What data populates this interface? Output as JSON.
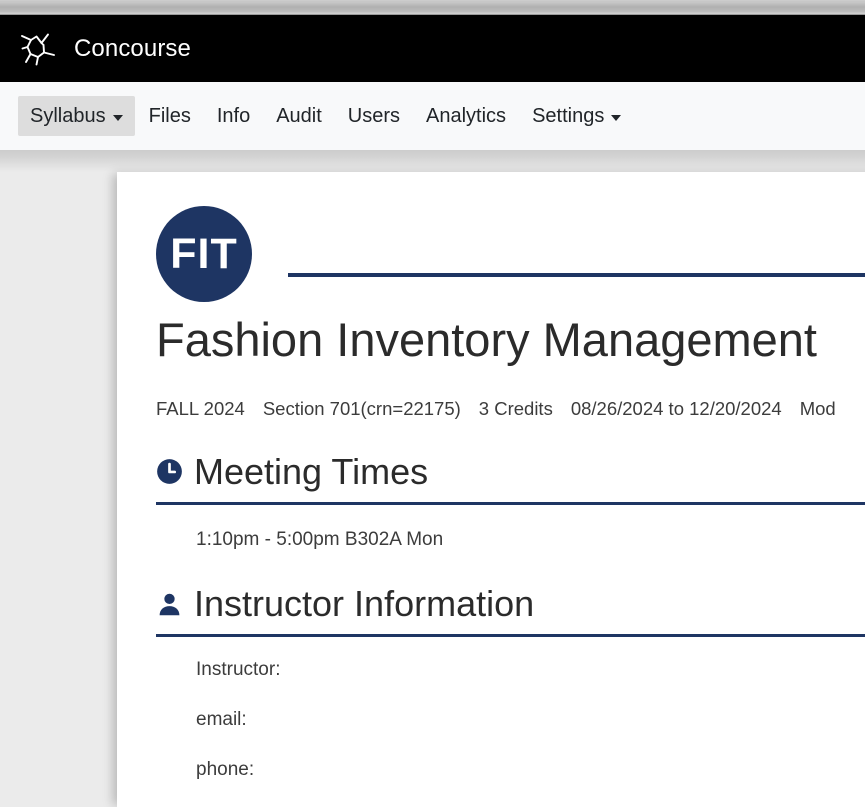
{
  "browser": {
    "scrollbar": "horizontal-scrollbar"
  },
  "header": {
    "brand_name": "Concourse",
    "logo_icon": "concourse-starburst-logo"
  },
  "nav": {
    "items": [
      {
        "label": "Syllabus",
        "has_caret": true,
        "active": true
      },
      {
        "label": "Files",
        "has_caret": false,
        "active": false
      },
      {
        "label": "Info",
        "has_caret": false,
        "active": false
      },
      {
        "label": "Audit",
        "has_caret": false,
        "active": false
      },
      {
        "label": "Users",
        "has_caret": false,
        "active": false
      },
      {
        "label": "Analytics",
        "has_caret": false,
        "active": false
      },
      {
        "label": "Settings",
        "has_caret": true,
        "active": false
      }
    ]
  },
  "course": {
    "badge_text": "FIT",
    "title": "Fashion Inventory Management",
    "meta": {
      "term": "FALL 2024",
      "section": "Section 701(crn=22175)",
      "credits": "3 Credits",
      "dates": "08/26/2024 to 12/20/2024",
      "modality": "Mod"
    }
  },
  "sections": [
    {
      "id": "meeting-times",
      "title": "Meeting Times",
      "icon": "clock-icon",
      "lines": [
        "1:10pm - 5:00pm B302A Mon"
      ]
    },
    {
      "id": "instructor-information",
      "title": "Instructor Information",
      "icon": "person-icon",
      "fields": [
        {
          "label": "Instructor:",
          "value": ""
        },
        {
          "label": "email:",
          "value": ""
        },
        {
          "label": "phone:",
          "value": ""
        }
      ]
    }
  ],
  "colors": {
    "brand_bar": "#000000",
    "navy": "#1e3563",
    "nav_bg": "#f8f9fa",
    "active_nav_bg": "#dddddd",
    "page_bg": "#ebebeb",
    "card_bg": "#ffffff"
  }
}
